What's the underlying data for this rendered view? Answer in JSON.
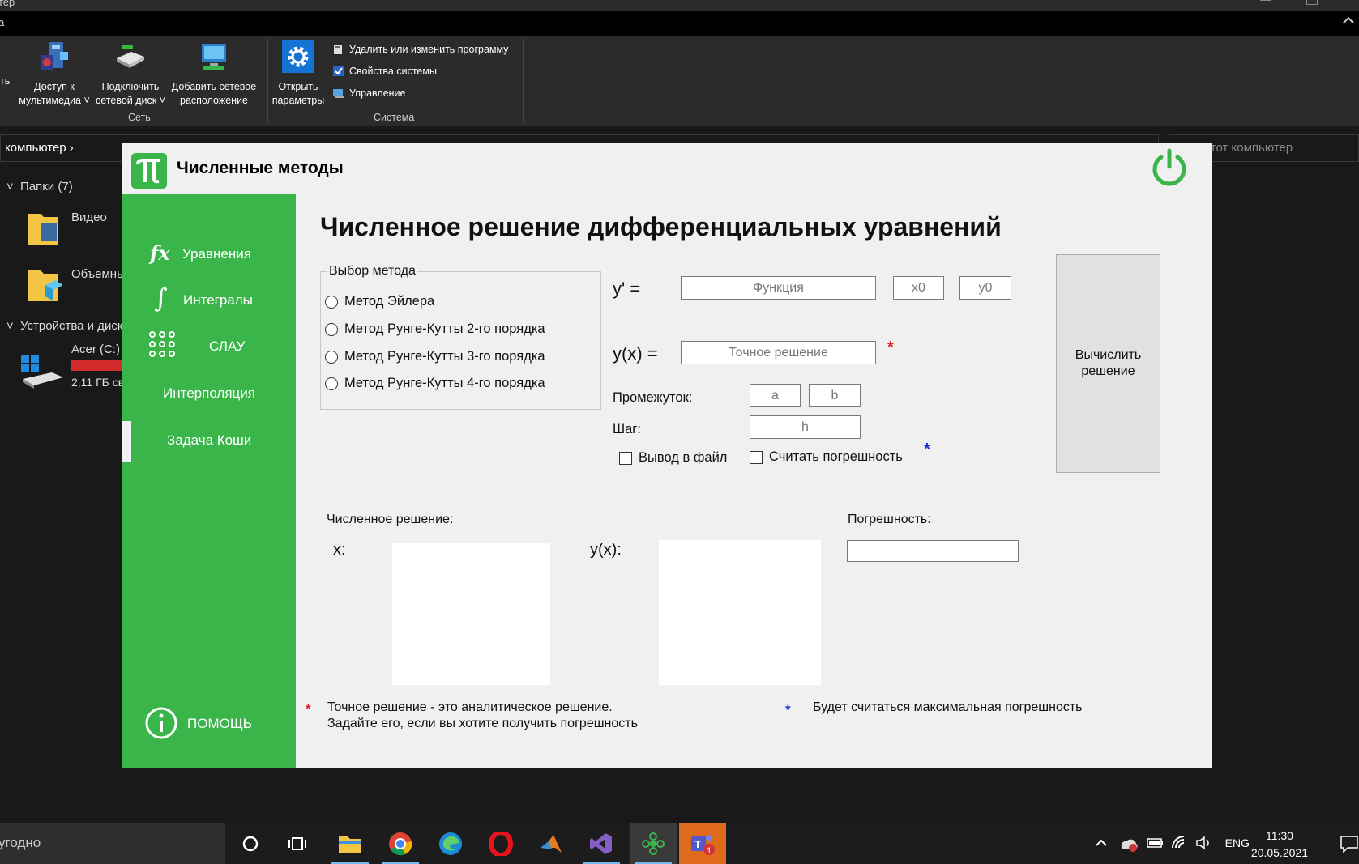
{
  "explorer": {
    "title_fragment": "тер",
    "tab_fragment": "а",
    "ribbon": {
      "left_fragment": "ть",
      "buttons": [
        {
          "label_line1": "Доступ к",
          "label_line2": "мультимедиа ˅"
        },
        {
          "label_line1": "Подключить",
          "label_line2": "сетевой диск ˅"
        },
        {
          "label_line1": "Добавить сетевое",
          "label_line2": "расположение"
        },
        {
          "label_line1": "Открыть",
          "label_line2": "параметры"
        }
      ],
      "small_items": [
        "Удалить или изменить программу",
        "Свойства системы",
        "Управление"
      ],
      "groups": [
        "Сеть",
        "Система"
      ]
    },
    "address": "компьютер  ›",
    "search_placeholder": "Этот компьютер",
    "nav": {
      "folders_header": "Папки (7)",
      "folder1": "Видео",
      "folder2": "Объемны",
      "devices_header": "Устройства и диски",
      "drive_name": "Acer (C:)",
      "drive_free": "2,11 ГБ св"
    }
  },
  "taskbar": {
    "search_text": "угодно",
    "lang": "ENG",
    "time": "11:30",
    "date": "20.05.2021",
    "notification_badge": "1"
  },
  "app": {
    "title": "Численные методы",
    "sidebar": {
      "items": [
        {
          "label": "Уравнения",
          "icon_text": "fx"
        },
        {
          "label": "Интегралы",
          "icon_text": "∫"
        },
        {
          "label": "СЛАУ"
        },
        {
          "label": "Интерполяция"
        },
        {
          "label": "Задача Коши"
        }
      ],
      "help": "ПОМОЩЬ"
    },
    "page_title": "Численное решение дифференциальных уравнений",
    "method_group": {
      "legend": "Выбор метода",
      "options": [
        "Метод Эйлера",
        "Метод Рунге-Кутты 2-го порядка",
        "Метод Рунге-Кутты 3-го порядка",
        "Метод Рунге-Кутты 4-го порядка"
      ]
    },
    "form": {
      "y_prime_label": "y' =",
      "func_placeholder": "Функция",
      "x0_placeholder": "x0",
      "y0_placeholder": "y0",
      "yx_label": "y(x) =",
      "exact_placeholder": "Точное решение",
      "interval_label": "Промежуток:",
      "a_placeholder": "a",
      "b_placeholder": "b",
      "step_label": "Шаг:",
      "h_placeholder": "h",
      "file_output": "Вывод в файл",
      "calc_error": "Считать погрешность",
      "star": "*"
    },
    "calc_button": {
      "line1": "Вычислить",
      "line2": "решение"
    },
    "results": {
      "numeric_label": "Численное решение:",
      "x_label": "x:",
      "yx_label": "y(x):",
      "error_label": "Погрешность:"
    },
    "notes": {
      "red_line1": "Точное решение - это аналитическое решение.",
      "red_line2": "Задайте его, если вы хотите получить погрешность",
      "blue": "Будет считаться максимальная погрешность"
    },
    "colors": {
      "accent": "#3ab54a",
      "red_star": "#e02020",
      "blue_star": "#1a2fe0"
    }
  }
}
